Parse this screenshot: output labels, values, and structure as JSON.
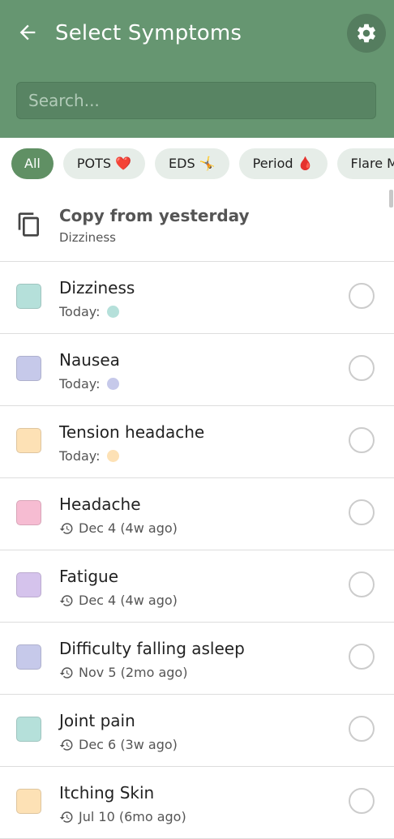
{
  "header": {
    "title": "Select Symptoms",
    "search_placeholder": "Search..."
  },
  "chips": [
    {
      "label": "All",
      "active": true
    },
    {
      "label": "POTS ❤️"
    },
    {
      "label": "EDS 🤸"
    },
    {
      "label": "Period 🩸"
    },
    {
      "label": "Flare Mode"
    }
  ],
  "copy": {
    "title": "Copy from yesterday",
    "subtitle": "Dizziness"
  },
  "symptoms": [
    {
      "name": "Dizziness",
      "when": "Today:",
      "color": "#b5e0da",
      "today": true
    },
    {
      "name": "Nausea",
      "when": "Today:",
      "color": "#c6c9ea",
      "today": true
    },
    {
      "name": "Tension headache",
      "when": "Today:",
      "color": "#fde1b5",
      "today": true
    },
    {
      "name": "Headache",
      "when": "Dec 4 (4w ago)",
      "color": "#f6bcd2",
      "today": false
    },
    {
      "name": "Fatigue",
      "when": "Dec 4 (4w ago)",
      "color": "#d5c3ec",
      "today": false
    },
    {
      "name": "Difficulty falling asleep",
      "when": "Nov 5 (2mo ago)",
      "color": "#c6c9ea",
      "today": false
    },
    {
      "name": "Joint pain",
      "when": "Dec 6 (3w ago)",
      "color": "#b5e0da",
      "today": false
    },
    {
      "name": "Itching Skin",
      "when": "Jul 10 (6mo ago)",
      "color": "#fde1b5",
      "today": false
    }
  ],
  "colors": {
    "header_bg": "#669671",
    "chip_active": "#609064",
    "chip_bg": "#e6ede8"
  }
}
